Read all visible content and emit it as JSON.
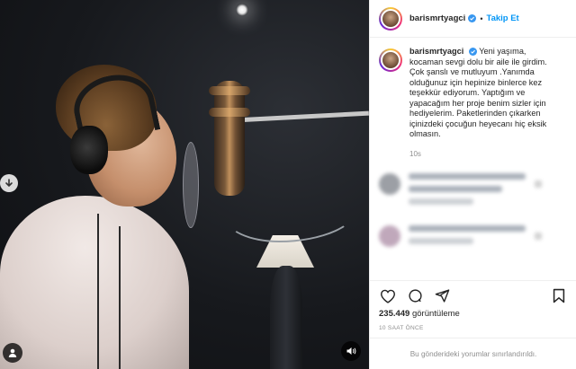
{
  "header": {
    "username": "barismrtyagci",
    "separator": "•",
    "follow_label": "Takip Et"
  },
  "caption": {
    "username": "barismrtyagci",
    "text": "Yeni yaşıma, kocaman sevgi dolu bir aile ile girdim. Çok şanslı ve mutluyum .Yanımda olduğunuz için hepinize binlerce kez teşekkür ediyorum. Yaptığım ve yapacağım her proje benim sizler için hediyelerim. Paketlerinden çıkarken içinizdeki çocuğun heyecanı hiç eksik olmasın.",
    "time": "10s"
  },
  "stats": {
    "views_count": "235.449",
    "views_label": "görüntüleme",
    "posted_ago": "10 SAAT ÖNCE"
  },
  "comments_disabled": "Bu gönderideki yorumlar sınırlandırıldı.",
  "colors": {
    "accent": "#0095f6",
    "verified": "#3897f0",
    "muted": "#8e8e8e"
  },
  "icons": {
    "media_left": "arrow-down-circle-icon",
    "media_user": "user-tag-icon",
    "media_sound": "speaker-icon",
    "like": "heart-icon",
    "comment": "comment-icon",
    "share": "send-icon",
    "save": "bookmark-icon"
  }
}
